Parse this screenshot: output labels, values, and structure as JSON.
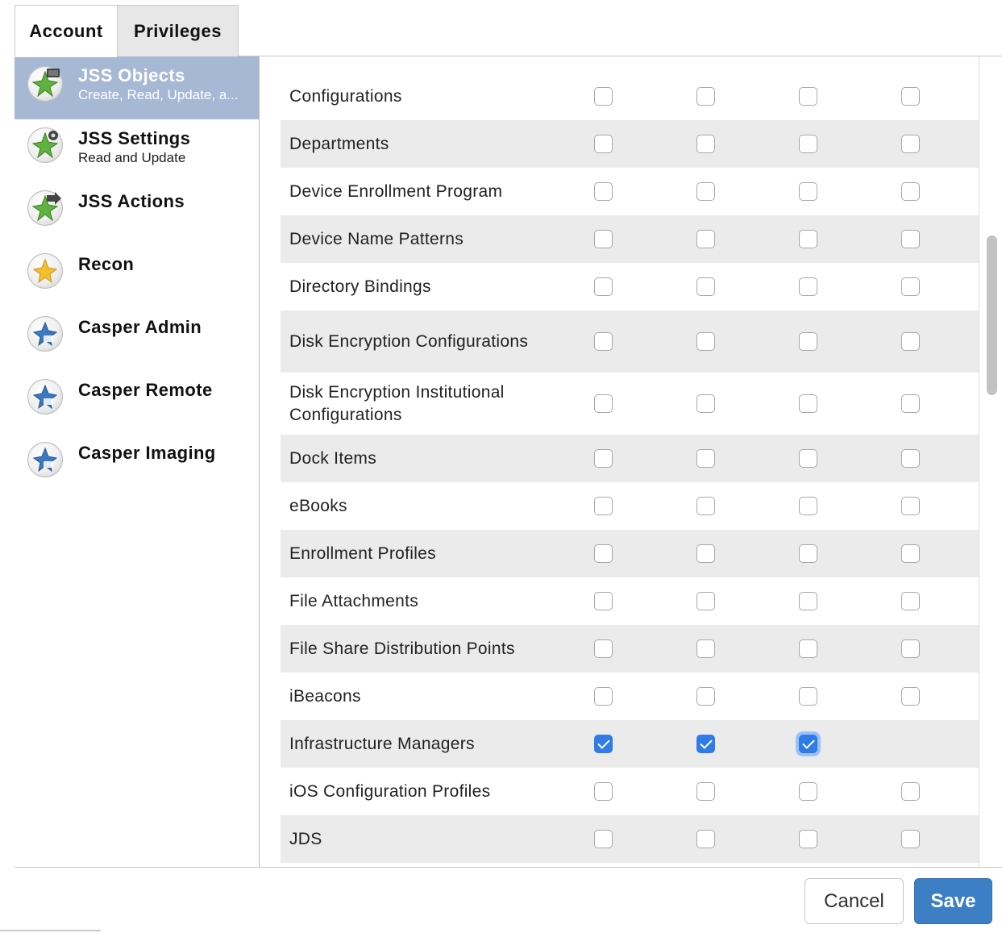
{
  "tabs": [
    {
      "label": "Account",
      "active": true
    },
    {
      "label": "Privileges",
      "active": false
    }
  ],
  "sidebar": {
    "items": [
      {
        "title": "JSS Objects",
        "subtitle": "Create, Read, Update, a...",
        "icon": "jss-objects-icon",
        "selected": true
      },
      {
        "title": "JSS Settings",
        "subtitle": "Read and Update",
        "icon": "jss-settings-icon",
        "selected": false
      },
      {
        "title": "JSS Actions",
        "subtitle": "",
        "icon": "jss-actions-icon",
        "selected": false
      },
      {
        "title": "Recon",
        "subtitle": "",
        "icon": "recon-icon",
        "selected": false
      },
      {
        "title": "Casper Admin",
        "subtitle": "",
        "icon": "casper-admin-icon",
        "selected": false
      },
      {
        "title": "Casper Remote",
        "subtitle": "",
        "icon": "casper-remote-icon",
        "selected": false
      },
      {
        "title": "Casper Imaging",
        "subtitle": "",
        "icon": "casper-imaging-icon",
        "selected": false
      }
    ]
  },
  "privileges": {
    "rows": [
      {
        "label": "Configurations",
        "checks": [
          false,
          false,
          false,
          false
        ]
      },
      {
        "label": "Departments",
        "checks": [
          false,
          false,
          false,
          false
        ]
      },
      {
        "label": "Device Enrollment Program",
        "checks": [
          false,
          false,
          false,
          false
        ]
      },
      {
        "label": "Device Name Patterns",
        "checks": [
          false,
          false,
          false,
          false
        ]
      },
      {
        "label": "Directory Bindings",
        "checks": [
          false,
          false,
          false,
          false
        ]
      },
      {
        "label": "Disk Encryption Configurations",
        "checks": [
          false,
          false,
          false,
          false
        ]
      },
      {
        "label": "Disk Encryption Institutional Configurations",
        "checks": [
          false,
          false,
          false,
          false
        ]
      },
      {
        "label": "Dock Items",
        "checks": [
          false,
          false,
          false,
          false
        ]
      },
      {
        "label": "eBooks",
        "checks": [
          false,
          false,
          false,
          false
        ]
      },
      {
        "label": "Enrollment Profiles",
        "checks": [
          false,
          false,
          false,
          false
        ]
      },
      {
        "label": "File Attachments",
        "checks": [
          false,
          false,
          false,
          false
        ]
      },
      {
        "label": "File Share Distribution Points",
        "checks": [
          false,
          false,
          false,
          false
        ]
      },
      {
        "label": "iBeacons",
        "checks": [
          false,
          false,
          false,
          false
        ]
      },
      {
        "label": "Infrastructure Managers",
        "checks": [
          true,
          true,
          true,
          null
        ]
      },
      {
        "label": "iOS Configuration Profiles",
        "checks": [
          false,
          false,
          false,
          false
        ]
      },
      {
        "label": "JDS",
        "checks": [
          false,
          false,
          false,
          false
        ]
      }
    ]
  },
  "footer": {
    "cancel_label": "Cancel",
    "save_label": "Save"
  },
  "colors": {
    "selected_sidebar_bg": "#a7b8d4",
    "checkbox_checked": "#2f7ce6",
    "save_button": "#3d7fc4",
    "row_stripe": "#ebebeb"
  }
}
